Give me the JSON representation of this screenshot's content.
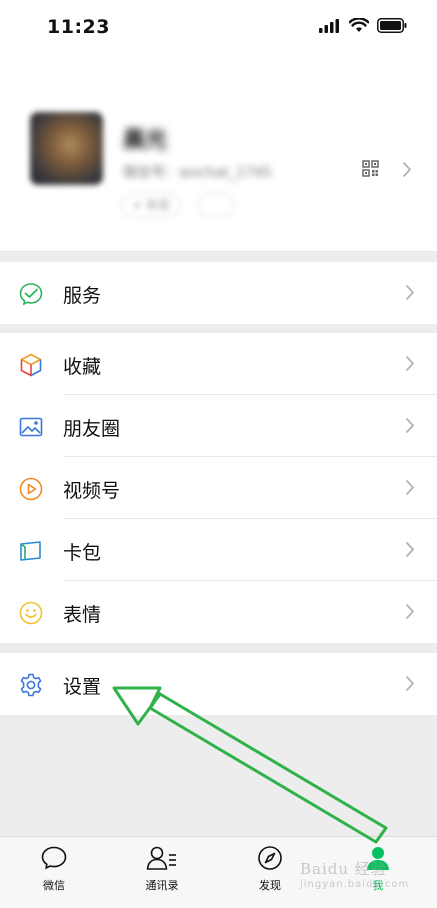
{
  "status_bar": {
    "time": "11:23"
  },
  "profile": {
    "nickname": "晨光",
    "wechat_id": "微信号：wxchat_1745",
    "status_label": "+ 状态"
  },
  "menu": {
    "services": {
      "label": "服务"
    },
    "favorites": {
      "label": "收藏"
    },
    "moments": {
      "label": "朋友圈"
    },
    "channels": {
      "label": "视频号"
    },
    "cards": {
      "label": "卡包"
    },
    "stickers": {
      "label": "表情"
    },
    "settings": {
      "label": "设置"
    }
  },
  "tabbar": {
    "tabs": [
      {
        "label": "微信",
        "icon": "chat-icon",
        "active": false
      },
      {
        "label": "通讯录",
        "icon": "contacts-icon",
        "active": false
      },
      {
        "label": "发现",
        "icon": "compass-icon",
        "active": false
      },
      {
        "label": "我",
        "icon": "me-icon",
        "active": true
      }
    ]
  },
  "watermark": {
    "text": "Baidu 经验",
    "subtext": "jingyan.baidu.com"
  },
  "colors": {
    "accent": "#07c160",
    "annotation_arrow": "#2fb24a",
    "background": "#ededed"
  }
}
